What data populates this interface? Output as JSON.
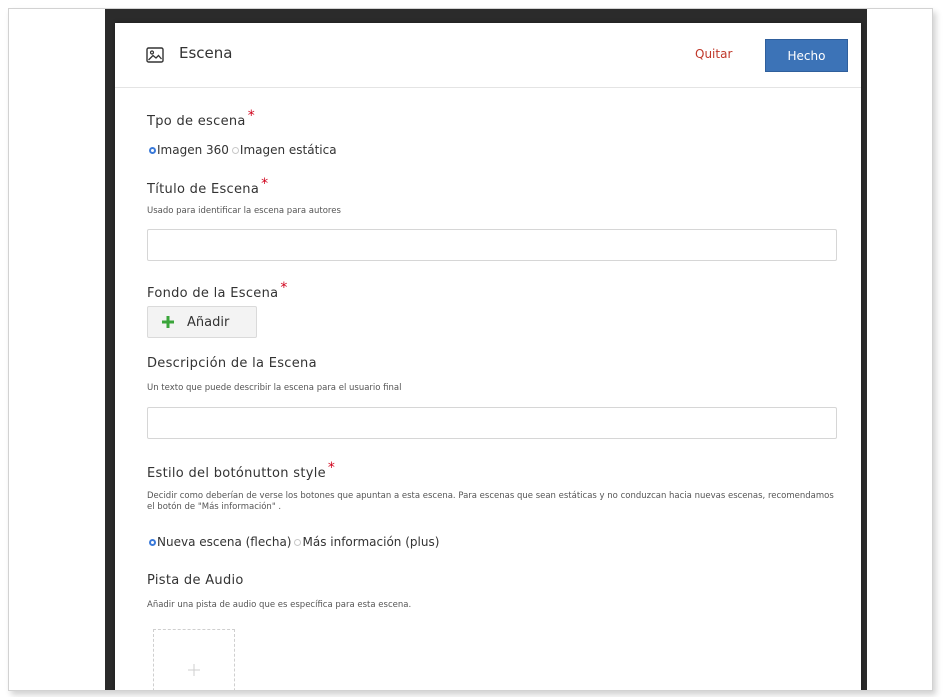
{
  "dialog": {
    "title": "Escena",
    "quit_label": "Quitar",
    "done_label": "Hecho"
  },
  "scene_type": {
    "label": "Tpo de escena",
    "required": "*",
    "options": [
      {
        "label": "Imagen 360",
        "checked": true
      },
      {
        "label": "Imagen estática",
        "checked": false
      }
    ]
  },
  "scene_title": {
    "label": "Título de Escena",
    "required": "*",
    "description": "Usado para identificar la escena para autores",
    "value": "",
    "placeholder": ""
  },
  "scene_background": {
    "label": "Fondo de la Escena",
    "required": "*",
    "add_label": "Añadir"
  },
  "scene_description": {
    "label": "Descripción de la Escena",
    "description": "Un texto que puede describir la escena para el usuario final",
    "value": "",
    "placeholder": ""
  },
  "button_style": {
    "label": "Estilo del botónutton style",
    "required": "*",
    "description": "Decidir como deberían de verse los botones que apuntan a esta escena. Para escenas que sean estáticas y no conduzcan hacia nuevas escenas, recomendamos el botón de \"Más información\" .",
    "options": [
      {
        "label": "Nueva escena (flecha)",
        "checked": true
      },
      {
        "label": "Más información (plus)",
        "checked": false
      }
    ]
  },
  "audio_track": {
    "label": "Pista de Audio",
    "description": "Añadir una pista de audio que es específica para esta escena."
  },
  "colors": {
    "accent": "#3c73b7",
    "danger": "#c0392b",
    "required": "#d0021b",
    "add_icon": "#3aa53a"
  },
  "icons": {
    "header": "image-icon",
    "add": "plus-icon",
    "audio": "plus-icon"
  }
}
